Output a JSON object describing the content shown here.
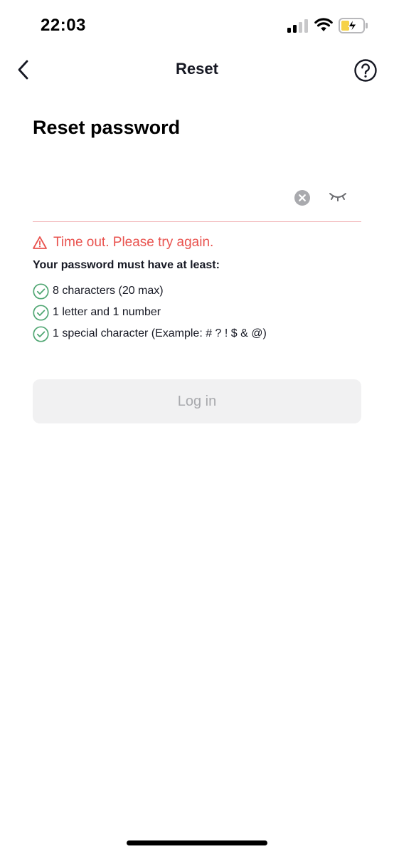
{
  "status_bar": {
    "time": "22:03",
    "icons": [
      "cellular-signal-icon",
      "wifi-icon",
      "battery-charging-icon"
    ]
  },
  "nav": {
    "title": "Reset",
    "back_icon": "chevron-left-icon",
    "help_icon": "question-circle-icon"
  },
  "page": {
    "heading": "Reset password"
  },
  "password_field": {
    "value": "",
    "clear_icon": "clear-circle-icon",
    "visibility_icon": "eye-closed-icon"
  },
  "error": {
    "icon": "warning-triangle-icon",
    "message": "Time out. Please try again."
  },
  "requirements": {
    "title": "Your password must have at least:",
    "items": [
      {
        "label": "8 characters (20 max)",
        "met": true
      },
      {
        "label": "1 letter and 1 number",
        "met": true
      },
      {
        "label": "1 special character (Example: # ? ! $ & @)",
        "met": true
      }
    ]
  },
  "login_button": {
    "label": "Log in",
    "enabled": false
  },
  "colors": {
    "error": "#e9534f",
    "check": "#4fa672",
    "button_bg": "#f1f1f2",
    "button_text": "#a8a9ad",
    "field_underline": "#f2b3b6"
  }
}
